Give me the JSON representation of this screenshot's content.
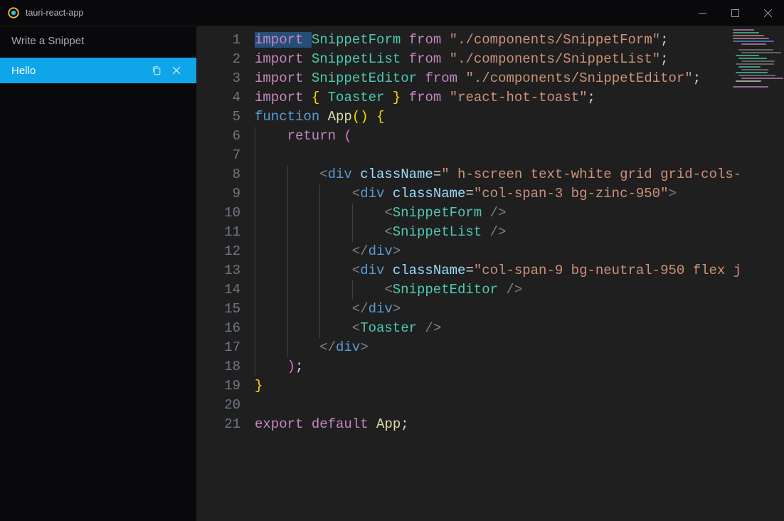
{
  "window": {
    "title": "tauri-react-app"
  },
  "sidebar": {
    "input_placeholder": "Write a Snippet",
    "items": [
      {
        "label": "Hello",
        "selected": true
      }
    ]
  },
  "editor": {
    "line_count": 21,
    "code_lines": [
      [
        {
          "t": "import ",
          "c": "k",
          "sel": true
        },
        {
          "t": "SnippetForm",
          "c": "fn"
        },
        {
          "t": " ",
          "c": "p"
        },
        {
          "t": "from",
          "c": "k"
        },
        {
          "t": " ",
          "c": "p"
        },
        {
          "t": "\"./components/SnippetForm\"",
          "c": "s"
        },
        {
          "t": ";",
          "c": "p"
        }
      ],
      [
        {
          "t": "import ",
          "c": "k"
        },
        {
          "t": "SnippetList",
          "c": "fn"
        },
        {
          "t": " ",
          "c": "p"
        },
        {
          "t": "from",
          "c": "k"
        },
        {
          "t": " ",
          "c": "p"
        },
        {
          "t": "\"./components/SnippetList\"",
          "c": "s"
        },
        {
          "t": ";",
          "c": "p"
        }
      ],
      [
        {
          "t": "import ",
          "c": "k"
        },
        {
          "t": "SnippetEditor",
          "c": "fn"
        },
        {
          "t": " ",
          "c": "p"
        },
        {
          "t": "from",
          "c": "k"
        },
        {
          "t": " ",
          "c": "p"
        },
        {
          "t": "\"./components/SnippetEditor\"",
          "c": "s"
        },
        {
          "t": ";",
          "c": "p"
        }
      ],
      [
        {
          "t": "import ",
          "c": "k"
        },
        {
          "t": "{ ",
          "c": "br"
        },
        {
          "t": "Toaster",
          "c": "fn"
        },
        {
          "t": " }",
          "c": "br"
        },
        {
          "t": " ",
          "c": "p"
        },
        {
          "t": "from",
          "c": "k"
        },
        {
          "t": " ",
          "c": "p"
        },
        {
          "t": "\"react-hot-toast\"",
          "c": "s"
        },
        {
          "t": ";",
          "c": "p"
        }
      ],
      [
        {
          "t": "function ",
          "c": "dname"
        },
        {
          "t": "App",
          "c": "fnc"
        },
        {
          "t": "(",
          "c": "br"
        },
        {
          "t": ")",
          "c": "br"
        },
        {
          "t": " ",
          "c": "p"
        },
        {
          "t": "{",
          "c": "br"
        }
      ],
      [
        {
          "t": "    ",
          "c": "p",
          "guide": 1
        },
        {
          "t": "return",
          "c": "k"
        },
        {
          "t": " ",
          "c": "p"
        },
        {
          "t": "(",
          "c": "br2"
        }
      ],
      [
        {
          "t": "    ",
          "c": "p",
          "guide": 1
        }
      ],
      [
        {
          "t": "        ",
          "c": "p",
          "guide": 2
        },
        {
          "t": "<",
          "c": "tag"
        },
        {
          "t": "div",
          "c": "dname"
        },
        {
          "t": " ",
          "c": "p"
        },
        {
          "t": "className",
          "c": "attr"
        },
        {
          "t": "=",
          "c": "op"
        },
        {
          "t": "\" h-screen text-white grid grid-cols-",
          "c": "s"
        }
      ],
      [
        {
          "t": "            ",
          "c": "p",
          "guide": 3
        },
        {
          "t": "<",
          "c": "tag"
        },
        {
          "t": "div",
          "c": "dname"
        },
        {
          "t": " ",
          "c": "p"
        },
        {
          "t": "className",
          "c": "attr"
        },
        {
          "t": "=",
          "c": "op"
        },
        {
          "t": "\"col-span-3 bg-zinc-950\"",
          "c": "s"
        },
        {
          "t": ">",
          "c": "tag"
        }
      ],
      [
        {
          "t": "                ",
          "c": "p",
          "guide": 4
        },
        {
          "t": "<",
          "c": "tag"
        },
        {
          "t": "SnippetForm",
          "c": "tname"
        },
        {
          "t": " />",
          "c": "tag"
        }
      ],
      [
        {
          "t": "                ",
          "c": "p",
          "guide": 4
        },
        {
          "t": "<",
          "c": "tag"
        },
        {
          "t": "SnippetList",
          "c": "tname"
        },
        {
          "t": " />",
          "c": "tag"
        }
      ],
      [
        {
          "t": "            ",
          "c": "p",
          "guide": 3
        },
        {
          "t": "</",
          "c": "tag"
        },
        {
          "t": "div",
          "c": "dname"
        },
        {
          "t": ">",
          "c": "tag"
        }
      ],
      [
        {
          "t": "            ",
          "c": "p",
          "guide": 3
        },
        {
          "t": "<",
          "c": "tag"
        },
        {
          "t": "div",
          "c": "dname"
        },
        {
          "t": " ",
          "c": "p"
        },
        {
          "t": "className",
          "c": "attr"
        },
        {
          "t": "=",
          "c": "op"
        },
        {
          "t": "\"col-span-9 bg-neutral-950 flex j",
          "c": "s"
        }
      ],
      [
        {
          "t": "                ",
          "c": "p",
          "guide": 4
        },
        {
          "t": "<",
          "c": "tag"
        },
        {
          "t": "SnippetEditor",
          "c": "tname"
        },
        {
          "t": " />",
          "c": "tag"
        }
      ],
      [
        {
          "t": "            ",
          "c": "p",
          "guide": 3
        },
        {
          "t": "</",
          "c": "tag"
        },
        {
          "t": "div",
          "c": "dname"
        },
        {
          "t": ">",
          "c": "tag"
        }
      ],
      [
        {
          "t": "            ",
          "c": "p",
          "guide": 3
        },
        {
          "t": "<",
          "c": "tag"
        },
        {
          "t": "Toaster",
          "c": "tname"
        },
        {
          "t": " />",
          "c": "tag"
        }
      ],
      [
        {
          "t": "        ",
          "c": "p",
          "guide": 2
        },
        {
          "t": "</",
          "c": "tag"
        },
        {
          "t": "div",
          "c": "dname"
        },
        {
          "t": ">",
          "c": "tag"
        }
      ],
      [
        {
          "t": "    ",
          "c": "p",
          "guide": 1
        },
        {
          "t": ")",
          "c": "br2"
        },
        {
          "t": ";",
          "c": "p"
        }
      ],
      [
        {
          "t": "}",
          "c": "br"
        }
      ],
      [
        {
          "t": "",
          "c": "p"
        }
      ],
      [
        {
          "t": "export ",
          "c": "k"
        },
        {
          "t": "default ",
          "c": "k"
        },
        {
          "t": "App",
          "c": "fnc"
        },
        {
          "t": ";",
          "c": "p"
        }
      ]
    ]
  },
  "colors": {
    "accent": "#0ea5e9",
    "editor_bg": "#1f1f1f",
    "sidebar_bg": "#09090b"
  }
}
